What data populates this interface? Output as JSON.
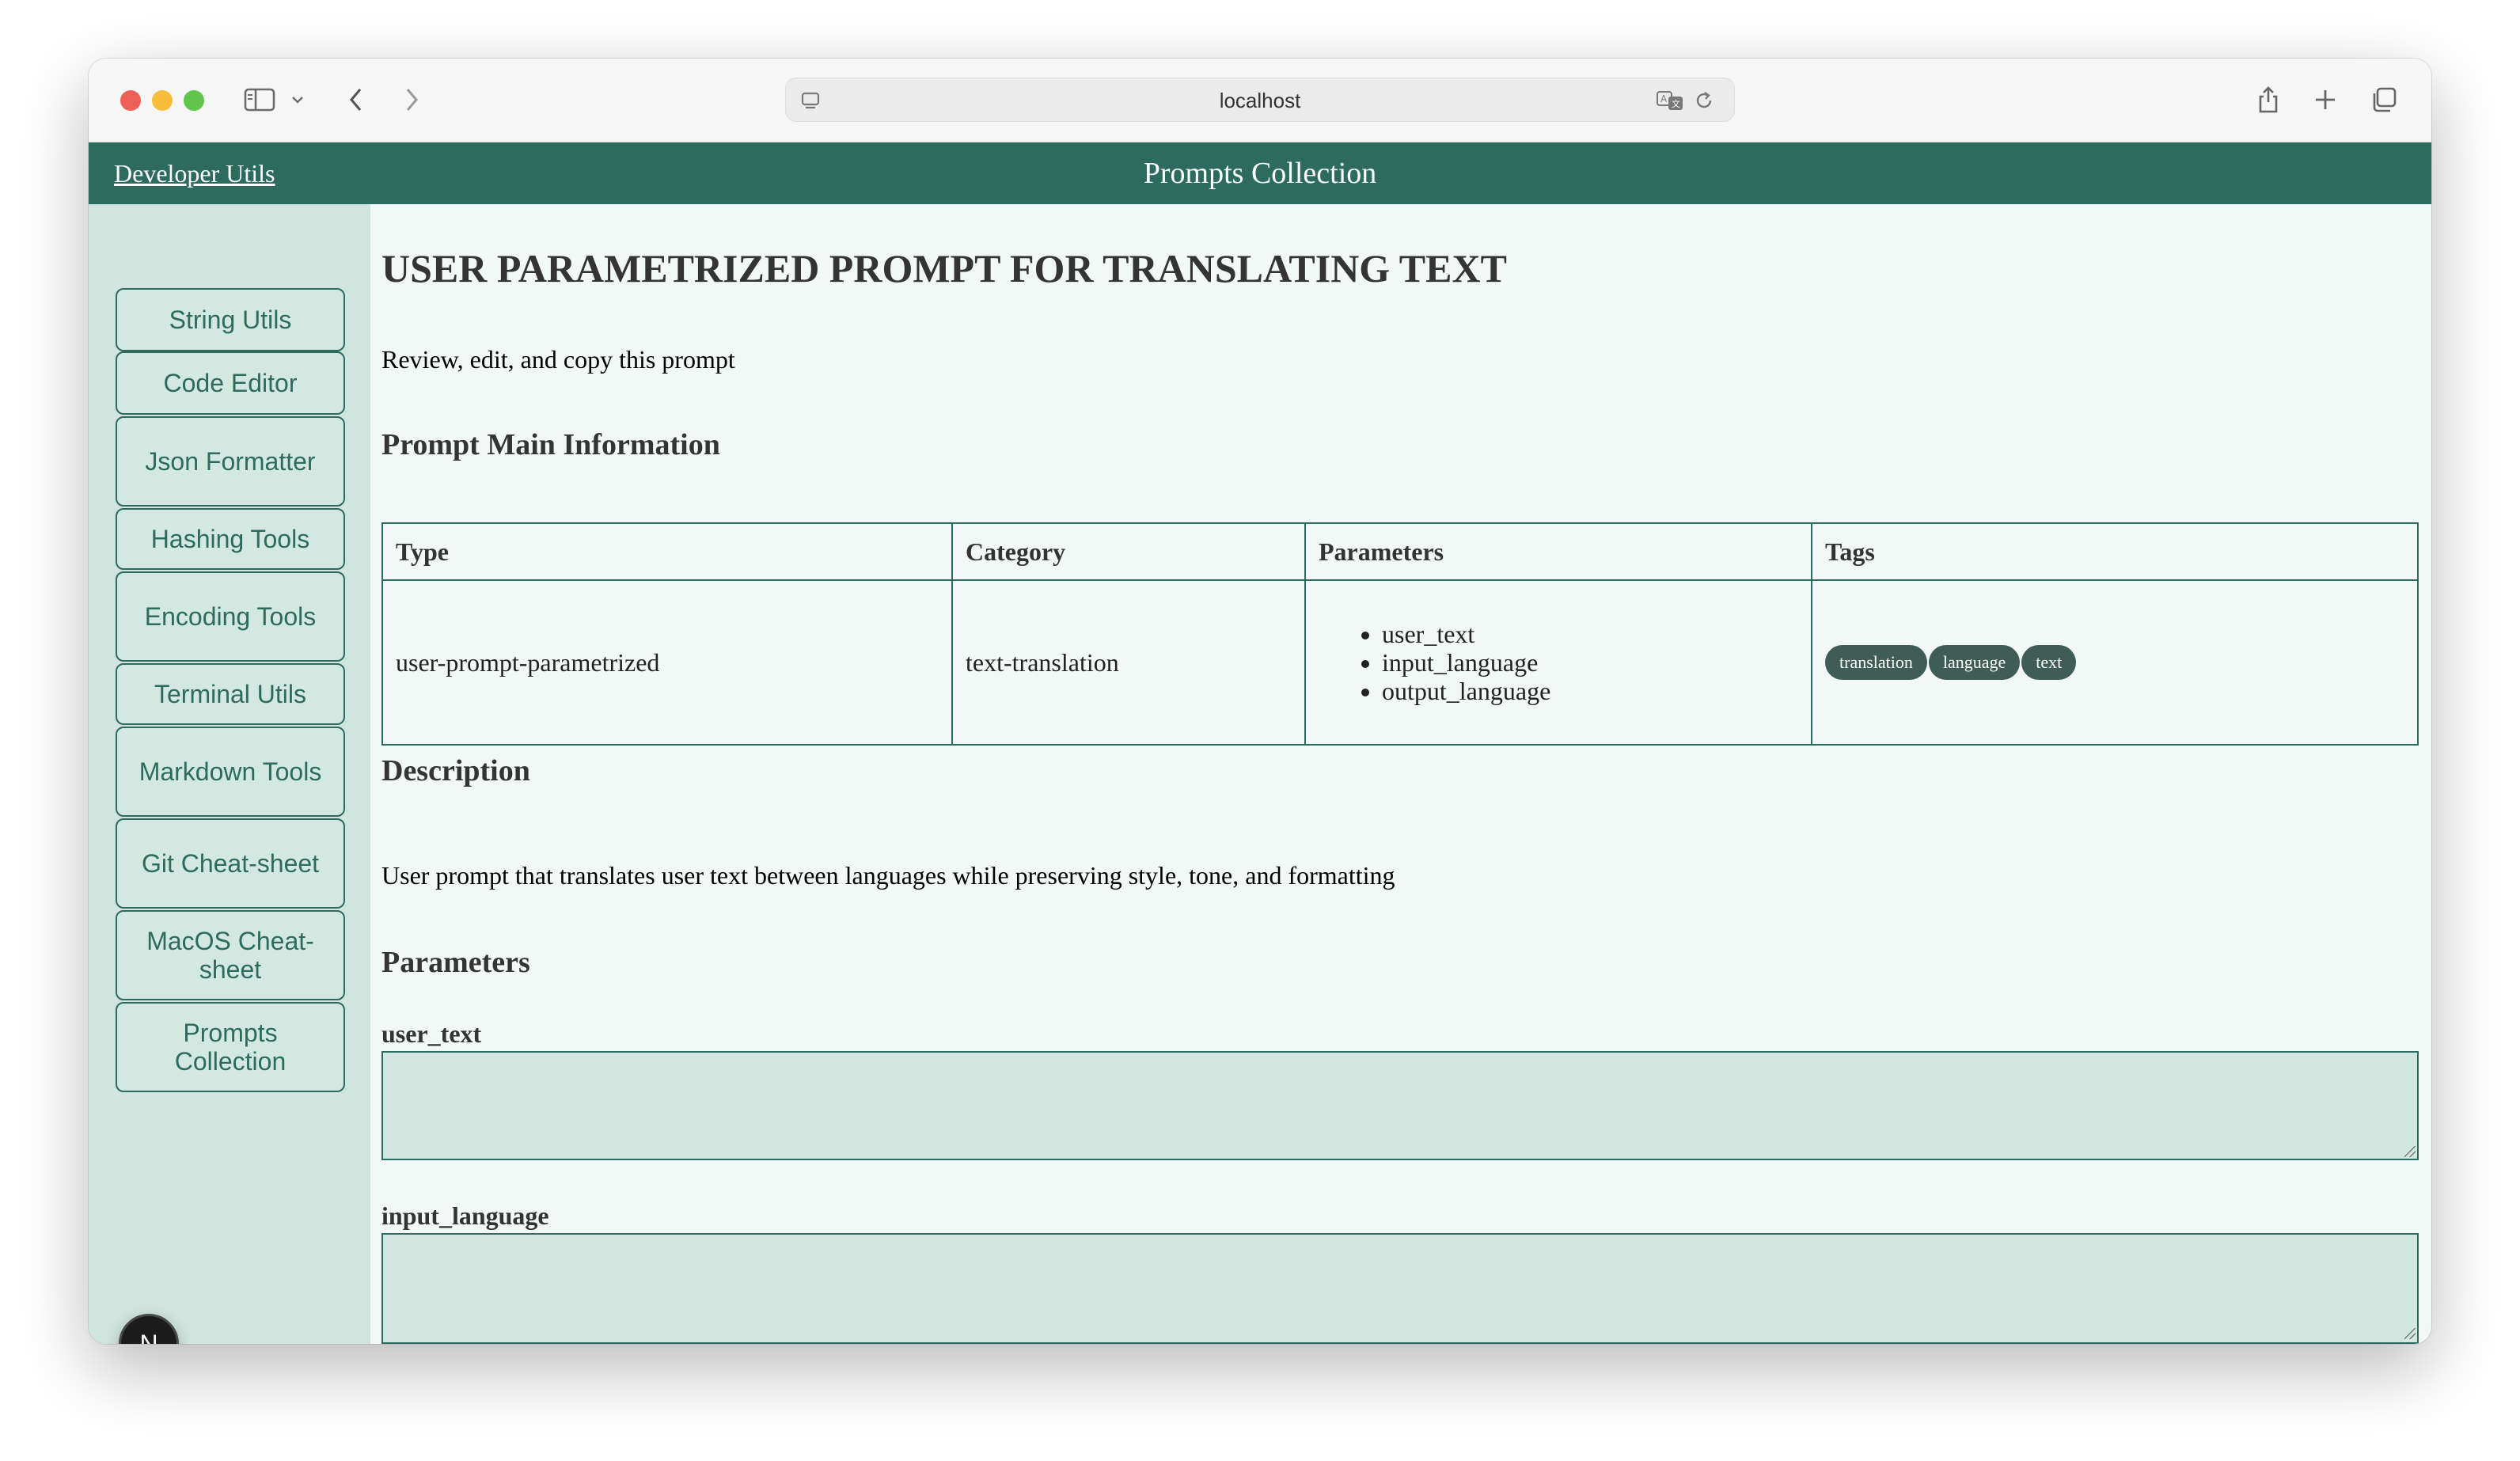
{
  "browser": {
    "url": "localhost"
  },
  "header": {
    "brand_link": "Developer Utils",
    "title": "Prompts Collection"
  },
  "sidebar": {
    "items": [
      {
        "label": "String Utils"
      },
      {
        "label": "Code Editor"
      },
      {
        "label": "Json Formatter"
      },
      {
        "label": "Hashing Tools"
      },
      {
        "label": "Encoding Tools"
      },
      {
        "label": "Terminal Utils"
      },
      {
        "label": "Markdown Tools"
      },
      {
        "label": "Git Cheat-sheet"
      },
      {
        "label": "MacOS Cheat-sheet"
      },
      {
        "label": "Prompts Collection"
      }
    ],
    "avatar_letter": "N"
  },
  "main": {
    "title": "USER PARAMETRIZED PROMPT FOR TRANSLATING TEXT",
    "subtitle": "Review, edit, and copy this prompt",
    "info_heading": "Prompt Main Information",
    "table": {
      "headers": [
        "Type",
        "Category",
        "Parameters",
        "Tags"
      ],
      "type": "user-prompt-parametrized",
      "category": "text-translation",
      "parameters": [
        "user_text",
        "input_language",
        "output_language"
      ],
      "tags": [
        "translation",
        "language",
        "text"
      ]
    },
    "description_heading": "Description",
    "description": "User prompt that translates user text between languages while preserving style, tone, and formatting",
    "parameters_heading": "Parameters",
    "fields": [
      {
        "label": "user_text",
        "value": ""
      },
      {
        "label": "input_language",
        "value": ""
      }
    ]
  },
  "colors": {
    "accent": "#2d6b5f",
    "sidebar_bg": "#cfe5de",
    "content_bg": "#f2f8f6",
    "tag_bg": "#3f5c55",
    "field_bg": "#d1e7e0"
  }
}
